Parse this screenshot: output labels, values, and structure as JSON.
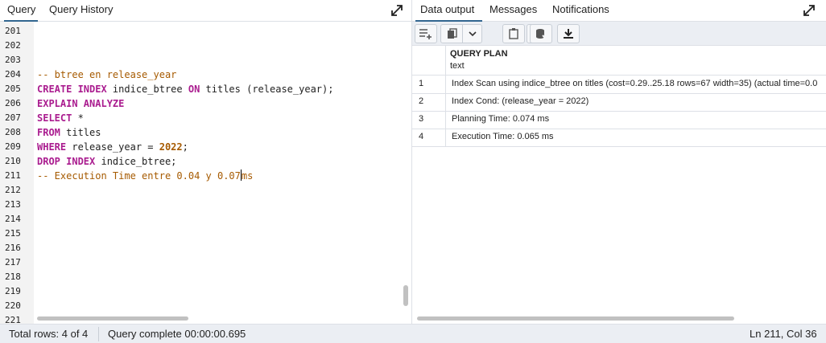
{
  "left_tabs": [
    "Query",
    "Query History"
  ],
  "right_tabs": [
    "Data output",
    "Messages",
    "Notifications"
  ],
  "line_numbers": [
    "201",
    "202",
    "203",
    "204",
    "205",
    "206",
    "207",
    "208",
    "209",
    "210",
    "211",
    "212",
    "213",
    "214",
    "215",
    "216",
    "217",
    "218",
    "219",
    "220",
    "221"
  ],
  "code_lines": [
    {
      "line": 4,
      "tokens": [
        {
          "t": "-- btree en release_year",
          "c": "cm"
        }
      ]
    },
    {
      "line": 5,
      "tokens": [
        {
          "t": "CREATE INDEX",
          "c": "kw"
        },
        {
          "t": " indice_btree ",
          "c": ""
        },
        {
          "t": "ON",
          "c": "kw"
        },
        {
          "t": " titles (release_year);",
          "c": ""
        }
      ]
    },
    {
      "line": 6,
      "tokens": [
        {
          "t": "EXPLAIN ANALYZE",
          "c": "kw"
        }
      ]
    },
    {
      "line": 7,
      "tokens": [
        {
          "t": "SELECT",
          "c": "kw"
        },
        {
          "t": " *",
          "c": ""
        }
      ]
    },
    {
      "line": 8,
      "tokens": [
        {
          "t": "FROM",
          "c": "kw"
        },
        {
          "t": " titles",
          "c": ""
        }
      ]
    },
    {
      "line": 9,
      "tokens": [
        {
          "t": "WHERE",
          "c": "kw"
        },
        {
          "t": " release_year = ",
          "c": ""
        },
        {
          "t": "2022",
          "c": "num"
        },
        {
          "t": ";",
          "c": ""
        }
      ]
    },
    {
      "line": 10,
      "tokens": [
        {
          "t": "DROP INDEX",
          "c": "kw"
        },
        {
          "t": " indice_btree;",
          "c": ""
        }
      ]
    },
    {
      "line": 11,
      "tokens": [
        {
          "t": "-- Execution Time entre 0.04 y 0.07",
          "c": "cm"
        },
        {
          "t": "|",
          "c": "cursor"
        },
        {
          "t": "ms",
          "c": "cm"
        }
      ]
    }
  ],
  "toolbar_icons": [
    "add-row-icon",
    "copy-icon",
    "dropdown-chevron-icon",
    "paste-icon",
    "delete-icon",
    "save-data-icon",
    "download-icon"
  ],
  "grid": {
    "column_name": "QUERY PLAN",
    "column_type": "text",
    "rows": [
      {
        "num": "1",
        "value": "Index Scan using indice_btree on titles (cost=0.29..25.18 rows=67 width=35) (actual time=0.0"
      },
      {
        "num": "2",
        "value": "Index Cond: (release_year = 2022)"
      },
      {
        "num": "3",
        "value": "Planning Time: 0.074 ms"
      },
      {
        "num": "4",
        "value": "Execution Time: 0.065 ms"
      }
    ]
  },
  "status": {
    "total_rows": "Total rows: 4 of 4",
    "query_complete": "Query complete 00:00:00.695",
    "cursor_pos": "Ln 211, Col 36"
  },
  "colors": {
    "keyword": "#aa1c8f",
    "comment": "#a65a00",
    "active_tab_underline": "#326690"
  }
}
